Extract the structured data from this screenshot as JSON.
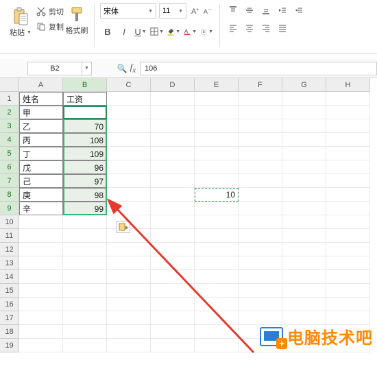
{
  "ribbon": {
    "paste_label": "粘贴",
    "cut_label": "剪切",
    "copy_label": "复制",
    "format_painter_label": "格式刷",
    "font_name": "宋体",
    "font_size": "11"
  },
  "name_box": "B2",
  "formula_value": "106",
  "columns": [
    "A",
    "B",
    "C",
    "D",
    "E",
    "F",
    "G",
    "H"
  ],
  "rows": [
    "1",
    "2",
    "3",
    "4",
    "5",
    "6",
    "7",
    "8",
    "9",
    "10",
    "11",
    "12",
    "13",
    "14",
    "15",
    "16",
    "17",
    "18",
    "19"
  ],
  "headers": {
    "a1": "姓名",
    "b1": "工资"
  },
  "table": [
    {
      "name": "甲",
      "value": "106"
    },
    {
      "name": "乙",
      "value": "70"
    },
    {
      "name": "丙",
      "value": "108"
    },
    {
      "name": "丁",
      "value": "109"
    },
    {
      "name": "戊",
      "value": "96"
    },
    {
      "name": "己",
      "value": "97"
    },
    {
      "name": "庚",
      "value": "98"
    },
    {
      "name": "辛",
      "value": "99"
    }
  ],
  "float_cell": "10",
  "watermark_text": "电脑技术吧"
}
